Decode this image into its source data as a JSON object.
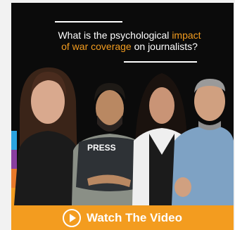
{
  "headline": {
    "part1": "What is the psychological ",
    "accent1": "impact",
    "part2": "of war coverage",
    "part3": " on journalists?"
  },
  "vest_label": "PRESS",
  "cta": {
    "label": "Watch The Video",
    "icon": "play-icon"
  },
  "colors": {
    "accent": "#f39c1f",
    "stripes": [
      "#2aa3e0",
      "#8a3fa0",
      "#e8792a",
      "#f39c1f"
    ]
  }
}
